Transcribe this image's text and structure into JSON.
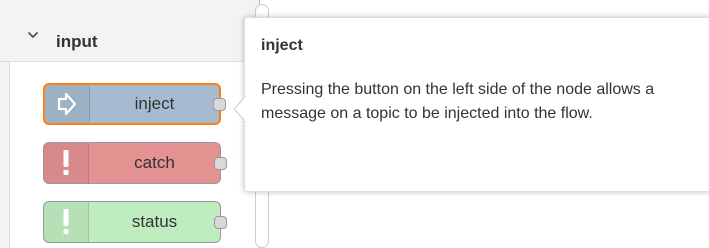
{
  "palette": {
    "category": {
      "label": "input",
      "icon": "chevron-down-icon",
      "expanded": true
    },
    "nodes": [
      {
        "label": "inject",
        "icon": "inject-arrow-icon",
        "color": "#a6bbcf",
        "selected": true
      },
      {
        "label": "catch",
        "icon": "exclamation-icon",
        "color": "#e49191",
        "selected": false
      },
      {
        "label": "status",
        "icon": "exclamation-icon",
        "color": "#c0edc0",
        "selected": false
      }
    ]
  },
  "tooltip": {
    "title": "inject",
    "description": "Pressing the button on the left side of the node allows a message on a topic to be injected into the flow."
  },
  "colors": {
    "selection_outline": "#ff7f0e",
    "palette_background": "#f3f3f3"
  }
}
